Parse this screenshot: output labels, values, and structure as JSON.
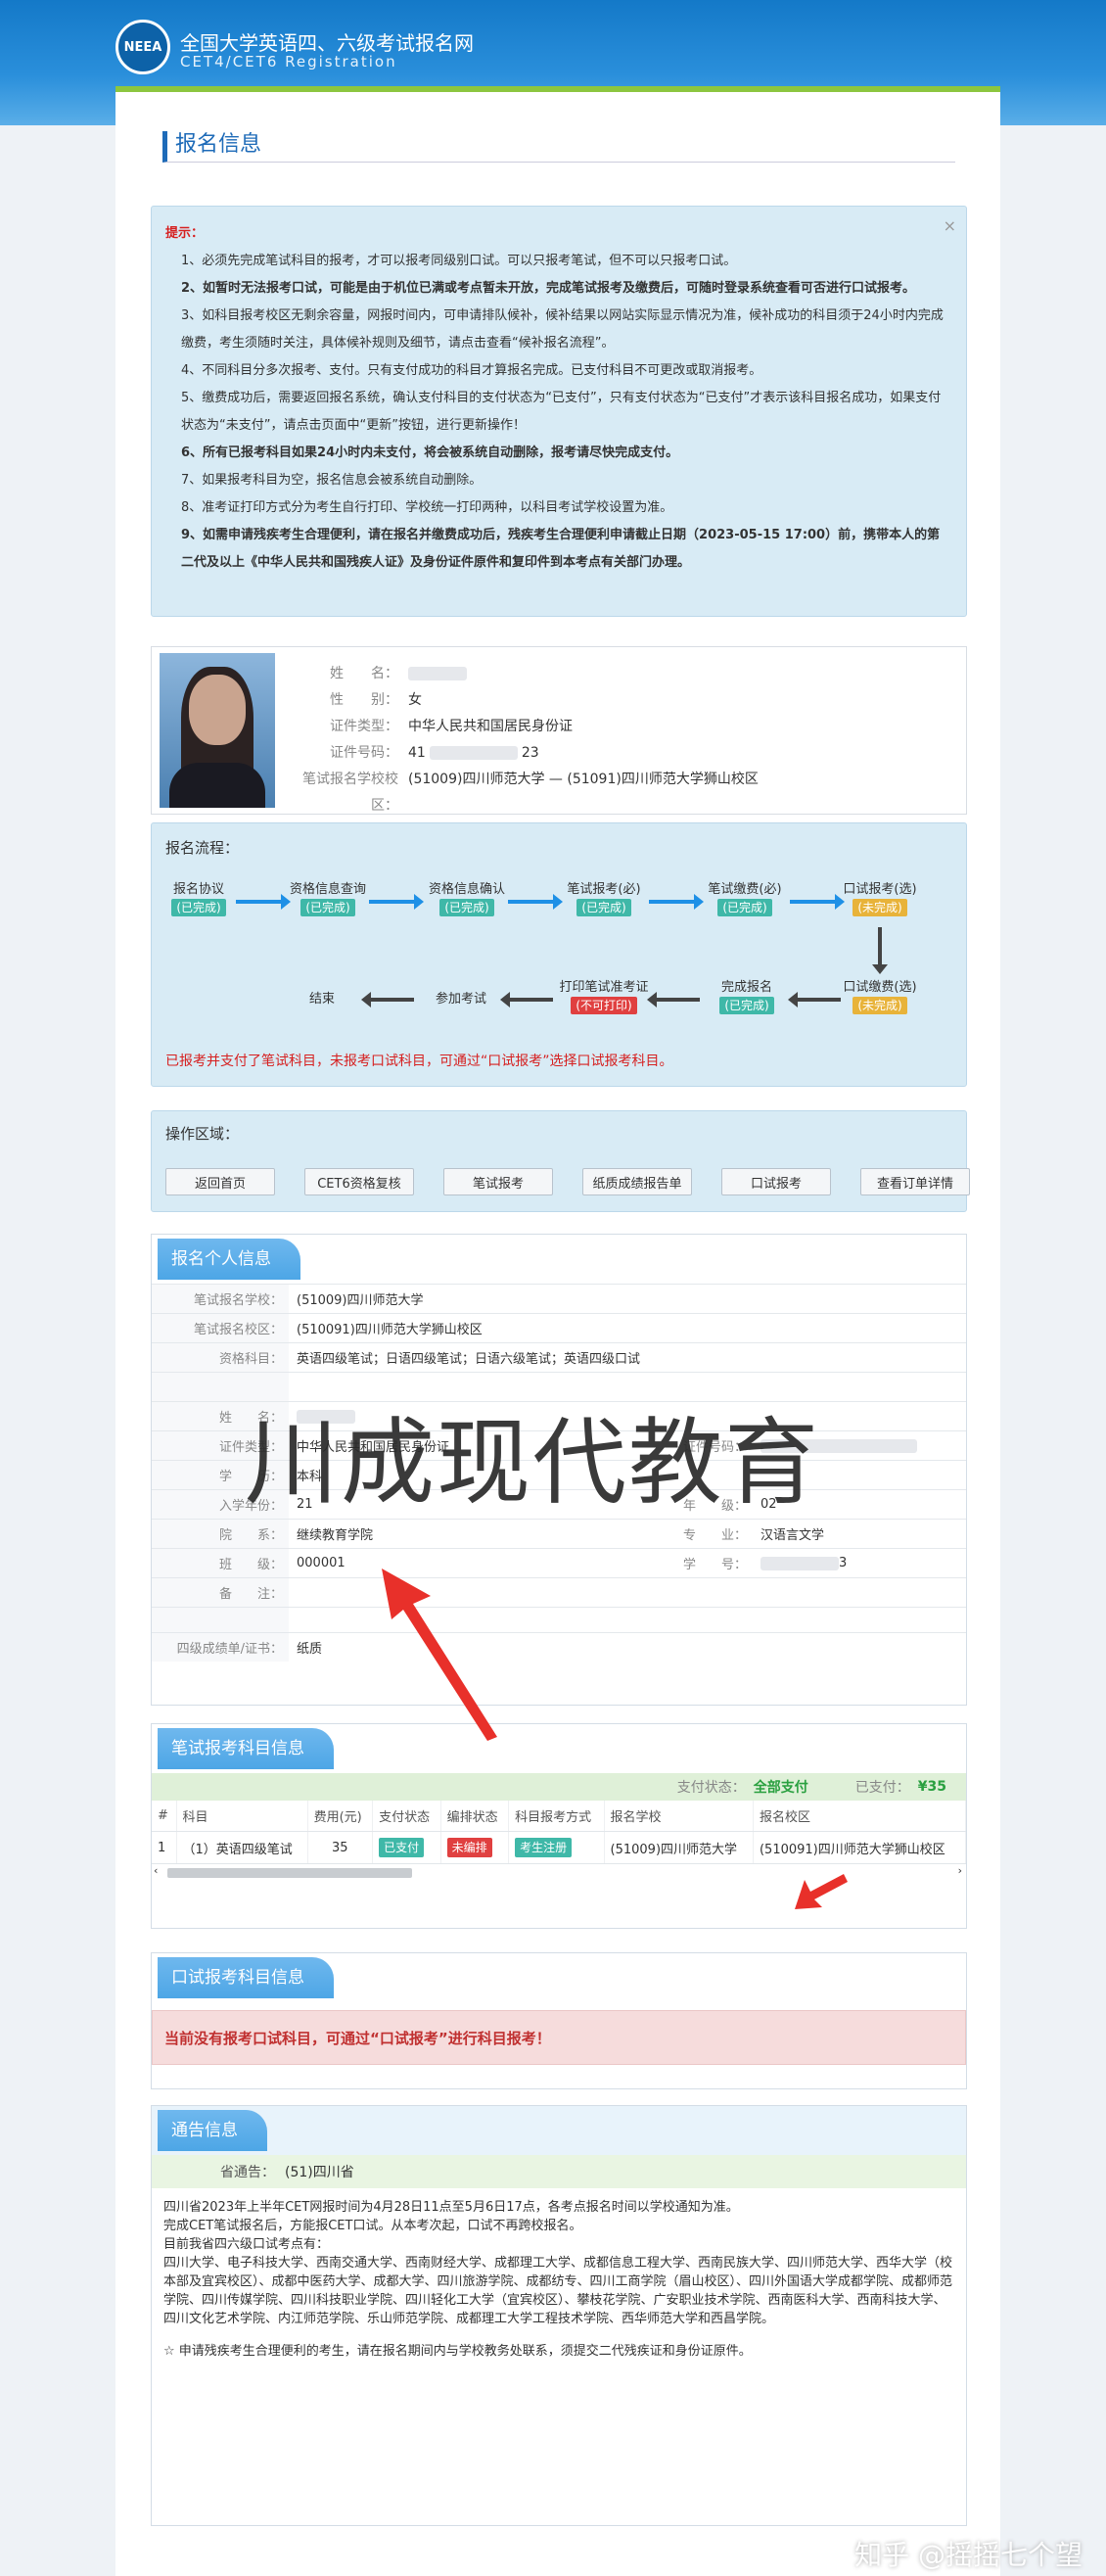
{
  "header": {
    "site_title": "全国大学英语四、六级考试报名网",
    "site_subtitle": "CET4/CET6  Registration",
    "logo_text": "NEEA"
  },
  "page_title": "报名信息",
  "tips": {
    "heading": "提示：",
    "close": "×",
    "items": [
      "1、必须先完成笔试科目的报考，才可以报考同级别口试。可以只报考笔试，但不可以只报考口试。",
      "2、如暂时无法报考口试，可能是由于机位已满或考点暂未开放，完成笔试报考及缴费后，可随时登录系统查看可否进行口试报考。",
      "3、如科目报考校区无剩余容量，网报时间内，可申请排队候补，候补结果以网站实际显示情况为准，候补成功的科目须于24小时内完成缴费，考生须随时关注，具体候补规则及细节，请点击查看“候补报名流程”。",
      "4、不同科目分多次报考、支付。只有支付成功的科目才算报名完成。已支付科目不可更改或取消报考。",
      "5、缴费成功后，需要返回报名系统，确认支付科目的支付状态为“已支付”，只有支付状态为“已支付”才表示该科目报名成功，如果支付状态为“未支付”，请点击页面中“更新”按钮，进行更新操作！",
      "6、所有已报考科目如果24小时内未支付，将会被系统自动删除，报考请尽快完成支付。",
      "7、如果报考科目为空，报名信息会被系统自动删除。",
      "8、准考证打印方式分为考生自行打印、学校统一打印两种，以科目考试学校设置为准。",
      "9、如需申请残疾考生合理便利，请在报名并缴费成功后，残疾考生合理便利申请截止日期（2023-05-15 17:00）前，携带本人的第二代及以上《中华人民共和国残疾人证》及身份证件原件和复印件到本考点有关部门办理。"
    ]
  },
  "person": {
    "labels": [
      "姓　　名：",
      "性　　别：",
      "证件类型：",
      "证件号码：",
      "笔试报名学校校区："
    ],
    "gender": "女",
    "id_type": "中华人民共和国居民身份证",
    "id_prefix": "41",
    "id_suffix": "23",
    "school": "(51009)四川师范大学 — (51091)四川师范大学狮山校区"
  },
  "flow": {
    "title": "报名流程：",
    "steps": [
      {
        "label": "报名协议",
        "status": "(已完成)"
      },
      {
        "label": "资格信息查询",
        "status": "(已完成)"
      },
      {
        "label": "资格信息确认",
        "status": "(已完成)"
      },
      {
        "label": "笔试报考(必)",
        "status": "(已完成)"
      },
      {
        "label": "笔试缴费(必)",
        "status": "(已完成)"
      },
      {
        "label": "口试报考(选)",
        "status": "(未完成)"
      },
      {
        "label": "口试缴费(选)",
        "status": "(未完成)"
      },
      {
        "label": "完成报名",
        "status": "(已完成)"
      },
      {
        "label": "打印笔试准考证",
        "status": "(不可打印)"
      },
      {
        "label": "参加考试",
        "status": ""
      },
      {
        "label": "结束",
        "status": ""
      }
    ],
    "note": "已报考并支付了笔试科目，未报考口试科目，可通过“口试报考”选择口试报考科目。"
  },
  "ops": {
    "title": "操作区域：",
    "buttons": [
      "返回首页",
      "CET6资格复核",
      "笔试报考",
      "纸质成绩报告单",
      "口试报考",
      "查看订单详情"
    ]
  },
  "personal": {
    "title": "报名个人信息",
    "rows": [
      {
        "k": "笔试报名学校：",
        "v": "(51009)四川师范大学"
      },
      {
        "k": "笔试报名校区：",
        "v": "(510091)四川师范大学狮山校区"
      },
      {
        "k": "资格科目：",
        "v": "英语四级笔试；日语四级笔试；日语六级笔试；英语四级口试"
      }
    ],
    "name_label": "姓　　名：",
    "id_type_label": "证件类型：",
    "id_type": "中华人民共和国居民身份证",
    "id_no_label": "证件号码：",
    "edu_label": "学　　历：",
    "edu": "本科",
    "year_label": "入学年份：",
    "year": "21",
    "grade_label": "年　　级：",
    "grade": "02",
    "dept_label": "院　　系：",
    "dept": "继续教育学院",
    "major_label": "专　　业：",
    "major": "汉语言文学",
    "class_label": "班　　级：",
    "class": "000001",
    "stuno_label": "学　　号：",
    "stuno_suffix": "3",
    "remark_label": "备　　注：",
    "cert_label": "四级成绩单/证书：",
    "cert": "纸质"
  },
  "watermark": "川成现代教育",
  "written": {
    "title": "笔试报考科目信息",
    "pay_label": "支付状态：",
    "pay_status": "全部支付",
    "paid_label": "已支付：",
    "paid_amount": "¥35",
    "headers": [
      "#",
      "科目",
      "费用(元)",
      "支付状态",
      "编排状态",
      "科目报考方式",
      "报名学校",
      "报名校区"
    ],
    "row": [
      "1",
      "（1）英语四级笔试",
      "35",
      "已支付",
      "未编排",
      "考生注册",
      "(51009)四川师范大学",
      "(510091)四川师范大学狮山校区"
    ]
  },
  "oral": {
    "title": "口试报考科目信息",
    "alert": "当前没有报考口试科目，可通过“口试报考”进行科目报考！"
  },
  "notice": {
    "title": "通告信息",
    "prov_label": "省通告：",
    "prov": "(51)四川省",
    "lines": [
      "四川省2023年上半年CET网报时间为4月28日11点至5月6日17点，各考点报名时间以学校通知为准。",
      "完成CET笔试报名后，方能报CET口试。从本考次起，口试不再跨校报名。",
      "目前我省四六级口试考点有：",
      "四川大学、电子科技大学、西南交通大学、西南财经大学、成都理工大学、成都信息工程大学、西南民族大学、四川师范大学、西华大学（校本部及宜宾校区）、成都中医药大学、成都大学、四川旅游学院、成都纺专、四川工商学院（眉山校区）、四川外国语大学成都学院、成都师范学院、四川传媒学院、四川科技职业学院、四川轻化工大学（宜宾校区）、攀枝花学院、广安职业技术学院、西南医科大学、西南科技大学、四川文化艺术学院、内江师范学院、乐山师范学院、成都理工大学工程技术学院、西华师范大学和西昌学院。",
      "☆ 申请残疾考生合理便利的考生，请在报名期间内与学校教务处联系，须提交二代残疾证和身份证原件。"
    ]
  },
  "footer_watermark": "知乎 @摇摇七个望"
}
